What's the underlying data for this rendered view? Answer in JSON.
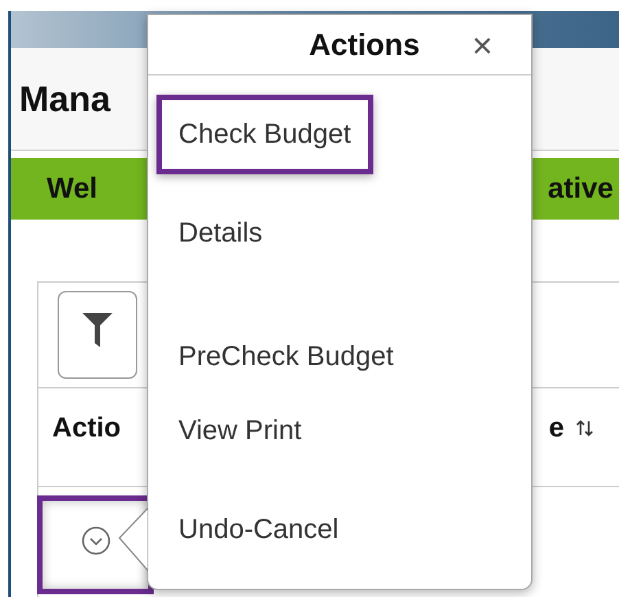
{
  "page": {
    "title": "Mana",
    "banner": {
      "left_text": "Wel",
      "right_text": "ative"
    }
  },
  "grid": {
    "columns": [
      {
        "label": "Actio",
        "sortable": false
      },
      {
        "label": "e",
        "sortable": true
      }
    ],
    "rows": [
      {
        "actions_button_highlighted": true
      }
    ]
  },
  "popup": {
    "title": "Actions",
    "close": "×",
    "items": [
      {
        "label": "Check Budget",
        "highlighted": true
      },
      {
        "label": "Details",
        "highlighted": false
      },
      {
        "label": "PreCheck Budget",
        "highlighted": false
      },
      {
        "label": "View Print",
        "highlighted": false
      },
      {
        "label": "Undo-Cancel",
        "highlighted": false
      }
    ]
  }
}
